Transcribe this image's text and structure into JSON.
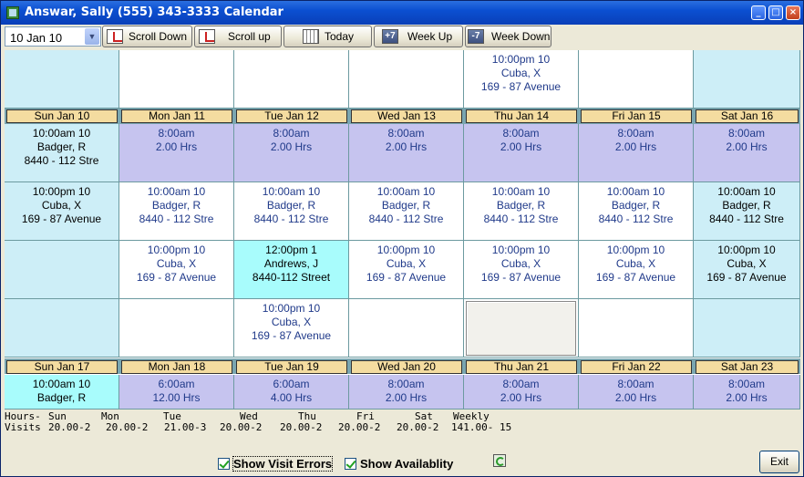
{
  "window": {
    "title": "Answar, Sally (555) 343-3333 Calendar",
    "min_label": "_",
    "max_label": "□",
    "close_label": "×"
  },
  "toolbar": {
    "date_value": "10 Jan 10",
    "scroll_down": "Scroll Down",
    "scroll_up": "Scroll up",
    "today": "Today",
    "week_up": "Week Up",
    "week_down": "Week Down",
    "week_up_badge": "+7",
    "week_down_badge": "-7"
  },
  "prev_week": [
    {
      "kind": "c",
      "lines": [
        "",
        "",
        ""
      ]
    },
    {
      "kind": "w",
      "lines": [
        "",
        "",
        ""
      ]
    },
    {
      "kind": "w",
      "lines": [
        "",
        "",
        ""
      ]
    },
    {
      "kind": "w",
      "lines": [
        "",
        "",
        ""
      ]
    },
    {
      "kind": "w",
      "lines": [
        "10:00pm 10",
        "Cuba, X",
        "169 - 87 Avenue"
      ]
    },
    {
      "kind": "w",
      "lines": [
        "",
        "",
        ""
      ]
    },
    {
      "kind": "c",
      "lines": [
        "",
        "",
        ""
      ]
    }
  ],
  "week1": {
    "days": [
      "Sun Jan 10",
      "Mon Jan 11",
      "Tue Jan 12",
      "Wed Jan 13",
      "Thu Jan 14",
      "Fri Jan 15",
      "Sat Jan 16"
    ],
    "rows": [
      [
        {
          "kind": "c",
          "dark": true,
          "lines": [
            "10:00am 10",
            "Badger, R",
            "8440 - 112 Stre"
          ]
        },
        {
          "kind": "p",
          "lines": [
            "8:00am",
            "2.00 Hrs",
            ""
          ]
        },
        {
          "kind": "p",
          "lines": [
            "8:00am",
            "2.00 Hrs",
            ""
          ]
        },
        {
          "kind": "p",
          "lines": [
            "8:00am",
            "2.00 Hrs",
            ""
          ]
        },
        {
          "kind": "p",
          "lines": [
            "8:00am",
            "2.00 Hrs",
            ""
          ]
        },
        {
          "kind": "p",
          "lines": [
            "8:00am",
            "2.00 Hrs",
            ""
          ]
        },
        {
          "kind": "p",
          "lines": [
            "8:00am",
            "2.00 Hrs",
            ""
          ]
        }
      ],
      [
        {
          "kind": "c",
          "dark": true,
          "lines": [
            "10:00pm 10",
            "Cuba, X",
            "169 - 87 Avenue"
          ]
        },
        {
          "kind": "w",
          "lines": [
            "10:00am 10",
            "Badger, R",
            "8440 - 112 Stre"
          ]
        },
        {
          "kind": "w",
          "lines": [
            "10:00am 10",
            "Badger, R",
            "8440 - 112 Stre"
          ]
        },
        {
          "kind": "w",
          "lines": [
            "10:00am 10",
            "Badger, R",
            "8440 - 112 Stre"
          ]
        },
        {
          "kind": "w",
          "lines": [
            "10:00am 10",
            "Badger, R",
            "8440 - 112 Stre"
          ]
        },
        {
          "kind": "w",
          "lines": [
            "10:00am 10",
            "Badger, R",
            "8440 - 112 Stre"
          ]
        },
        {
          "kind": "c",
          "dark": true,
          "lines": [
            "10:00am 10",
            "Badger, R",
            "8440 - 112 Stre"
          ]
        }
      ],
      [
        {
          "kind": "c",
          "lines": [
            "",
            "",
            ""
          ]
        },
        {
          "kind": "w",
          "lines": [
            "10:00pm 10",
            "Cuba, X",
            "169 - 87 Avenue"
          ]
        },
        {
          "kind": "a",
          "dark": true,
          "lines": [
            "12:00pm 1",
            "Andrews, J",
            "8440-112 Street"
          ]
        },
        {
          "kind": "w",
          "lines": [
            "10:00pm 10",
            "Cuba, X",
            "169 - 87 Avenue"
          ]
        },
        {
          "kind": "w",
          "lines": [
            "10:00pm 10",
            "Cuba, X",
            "169 - 87 Avenue"
          ]
        },
        {
          "kind": "w",
          "lines": [
            "10:00pm 10",
            "Cuba, X",
            "169 - 87 Avenue"
          ]
        },
        {
          "kind": "c",
          "dark": true,
          "lines": [
            "10:00pm 10",
            "Cuba, X",
            "169 - 87 Avenue"
          ]
        }
      ],
      [
        {
          "kind": "c",
          "lines": [
            "",
            "",
            ""
          ]
        },
        {
          "kind": "w",
          "lines": [
            "",
            "",
            ""
          ]
        },
        {
          "kind": "w",
          "lines": [
            "10:00pm 10",
            "Cuba, X",
            "169 - 87 Avenue"
          ]
        },
        {
          "kind": "w",
          "lines": [
            "",
            "",
            ""
          ]
        },
        {
          "kind": "g",
          "lines": [
            "",
            "",
            ""
          ]
        },
        {
          "kind": "w",
          "lines": [
            "",
            "",
            ""
          ]
        },
        {
          "kind": "c",
          "lines": [
            "",
            "",
            ""
          ]
        }
      ]
    ]
  },
  "week2": {
    "days": [
      "Sun Jan 17",
      "Mon Jan 18",
      "Tue Jan 19",
      "Wed Jan 20",
      "Thu Jan 21",
      "Fri Jan 22",
      "Sat Jan 23"
    ],
    "row": [
      {
        "kind": "a",
        "dark": true,
        "lines": [
          "10:00am 10",
          "Badger, R"
        ]
      },
      {
        "kind": "p",
        "lines": [
          "6:00am",
          "12.00 Hrs"
        ]
      },
      {
        "kind": "p",
        "lines": [
          "6:00am",
          "4.00 Hrs"
        ]
      },
      {
        "kind": "p",
        "lines": [
          "8:00am",
          "2.00 Hrs"
        ]
      },
      {
        "kind": "p",
        "lines": [
          "8:00am",
          "2.00 Hrs"
        ]
      },
      {
        "kind": "p",
        "lines": [
          "8:00am",
          "2.00 Hrs"
        ]
      },
      {
        "kind": "p",
        "lines": [
          "8:00am",
          "2.00 Hrs"
        ]
      }
    ]
  },
  "summary": {
    "row1_label": "Hours-",
    "row2_label": "Visits",
    "headers": [
      "Sun",
      "Mon",
      "Tue",
      "Wed",
      "Thu",
      "Fri",
      "Sat",
      "Weekly"
    ],
    "values": [
      "20.00-2",
      "20.00-2",
      "21.00-3",
      "20.00-2",
      "20.00-2",
      "20.00-2",
      "20.00-2",
      "141.00- 15"
    ]
  },
  "options": {
    "show_visit_errors": "Show Visit Errors",
    "show_availability": "Show Availablity"
  },
  "exit_label": "Exit",
  "colors": {
    "titlebar": "#0b4fd1",
    "purple_cell": "#c6c4ef",
    "cyan_cell": "#cdeef7",
    "aqua_cell": "#a8fcfc",
    "day_header": "#f4dca0",
    "appointment_text": "#203a8a"
  }
}
